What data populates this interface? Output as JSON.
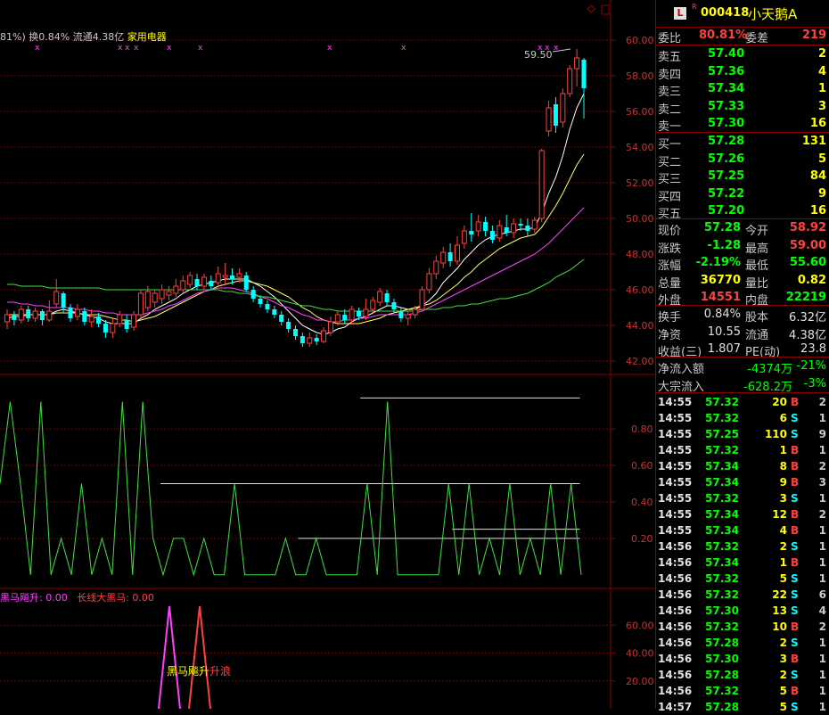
{
  "stock": {
    "code": "000418",
    "name": "小天鹅A",
    "badge": "L",
    "badge_sup": "R"
  },
  "info_bar": {
    "turnover_prefix": "81%) ",
    "turnover": "换0.84%",
    "float": "流通4.38亿",
    "sector": "家用电器"
  },
  "price_chart": {
    "ylim": [
      41.5,
      61
    ],
    "yticks": [
      "60.00",
      "58.00",
      "56.00",
      "54.00",
      "52.00",
      "50.00",
      "48.00",
      "46.00",
      "44.00",
      "42.00"
    ],
    "peak_label": "59.50",
    "candles": [
      {
        "o": 44.2,
        "c": 44.6,
        "h": 44.9,
        "l": 43.8
      },
      {
        "o": 44.6,
        "c": 44.3,
        "h": 44.8,
        "l": 44.0
      },
      {
        "o": 44.3,
        "c": 44.9,
        "h": 45.1,
        "l": 44.1
      },
      {
        "o": 44.9,
        "c": 44.4,
        "h": 45.1,
        "l": 44.2
      },
      {
        "o": 44.4,
        "c": 44.8,
        "h": 45.0,
        "l": 44.2
      },
      {
        "o": 44.8,
        "c": 44.3,
        "h": 44.9,
        "l": 44.0
      },
      {
        "o": 44.3,
        "c": 44.8,
        "h": 45.4,
        "l": 44.2
      },
      {
        "o": 45.2,
        "c": 45.9,
        "h": 46.6,
        "l": 45.0
      },
      {
        "o": 45.8,
        "c": 45.0,
        "h": 45.9,
        "l": 44.7
      },
      {
        "o": 45.0,
        "c": 44.4,
        "h": 45.2,
        "l": 44.2
      },
      {
        "o": 44.5,
        "c": 44.9,
        "h": 45.2,
        "l": 44.3
      },
      {
        "o": 44.8,
        "c": 44.2,
        "h": 45.0,
        "l": 44.0
      },
      {
        "o": 44.2,
        "c": 44.5,
        "h": 44.9,
        "l": 43.9
      },
      {
        "o": 44.5,
        "c": 44.1,
        "h": 44.7,
        "l": 43.9
      },
      {
        "o": 44.1,
        "c": 43.6,
        "h": 44.3,
        "l": 43.3
      },
      {
        "o": 43.6,
        "c": 44.1,
        "h": 44.4,
        "l": 43.3
      },
      {
        "o": 44.1,
        "c": 44.6,
        "h": 44.8,
        "l": 43.9
      },
      {
        "o": 44.3,
        "c": 43.8,
        "h": 44.6,
        "l": 43.6
      },
      {
        "o": 43.9,
        "c": 44.6,
        "h": 44.8,
        "l": 43.7
      },
      {
        "o": 44.6,
        "c": 45.8,
        "h": 46.0,
        "l": 44.4
      },
      {
        "o": 45.0,
        "c": 45.9,
        "h": 46.2,
        "l": 44.8
      },
      {
        "o": 45.3,
        "c": 45.8,
        "h": 46.0,
        "l": 45.0
      },
      {
        "o": 45.5,
        "c": 46.0,
        "h": 46.3,
        "l": 45.2
      },
      {
        "o": 45.7,
        "c": 45.9,
        "h": 46.2,
        "l": 45.4
      },
      {
        "o": 45.8,
        "c": 46.2,
        "h": 46.6,
        "l": 45.6
      },
      {
        "o": 46.0,
        "c": 46.5,
        "h": 46.8,
        "l": 45.8
      },
      {
        "o": 46.3,
        "c": 46.8,
        "h": 47.0,
        "l": 46.1
      },
      {
        "o": 46.6,
        "c": 46.2,
        "h": 46.9,
        "l": 46.0
      },
      {
        "o": 46.2,
        "c": 46.7,
        "h": 46.9,
        "l": 46.0
      },
      {
        "o": 46.5,
        "c": 46.2,
        "h": 46.8,
        "l": 46.0
      },
      {
        "o": 46.4,
        "c": 46.9,
        "h": 47.3,
        "l": 46.2
      },
      {
        "o": 46.7,
        "c": 46.8,
        "h": 47.5,
        "l": 46.3
      },
      {
        "o": 46.8,
        "c": 46.6,
        "h": 47.2,
        "l": 46.3
      },
      {
        "o": 46.7,
        "c": 46.9,
        "h": 47.2,
        "l": 46.4
      },
      {
        "o": 46.8,
        "c": 46.0,
        "h": 47.0,
        "l": 45.9
      },
      {
        "o": 46.0,
        "c": 45.5,
        "h": 46.2,
        "l": 45.3
      },
      {
        "o": 45.5,
        "c": 45.2,
        "h": 45.7,
        "l": 45.0
      },
      {
        "o": 45.2,
        "c": 44.9,
        "h": 45.4,
        "l": 44.7
      },
      {
        "o": 44.9,
        "c": 44.6,
        "h": 45.1,
        "l": 44.4
      },
      {
        "o": 44.6,
        "c": 44.2,
        "h": 44.8,
        "l": 44.0
      },
      {
        "o": 44.2,
        "c": 43.8,
        "h": 44.4,
        "l": 43.6
      },
      {
        "o": 43.8,
        "c": 43.4,
        "h": 44.0,
        "l": 43.2
      },
      {
        "o": 43.4,
        "c": 43.0,
        "h": 43.6,
        "l": 42.8
      },
      {
        "o": 43.0,
        "c": 43.3,
        "h": 43.6,
        "l": 42.8
      },
      {
        "o": 43.3,
        "c": 43.1,
        "h": 43.5,
        "l": 42.9
      },
      {
        "o": 43.1,
        "c": 43.7,
        "h": 43.9,
        "l": 43.0
      },
      {
        "o": 43.6,
        "c": 44.2,
        "h": 44.5,
        "l": 43.4
      },
      {
        "o": 44.2,
        "c": 44.6,
        "h": 44.8,
        "l": 44.0
      },
      {
        "o": 44.6,
        "c": 44.3,
        "h": 44.9,
        "l": 44.1
      },
      {
        "o": 44.3,
        "c": 44.9,
        "h": 45.1,
        "l": 44.1
      },
      {
        "o": 44.8,
        "c": 44.5,
        "h": 45.0,
        "l": 44.3
      },
      {
        "o": 44.5,
        "c": 44.9,
        "h": 45.5,
        "l": 44.3
      },
      {
        "o": 44.9,
        "c": 45.4,
        "h": 45.6,
        "l": 44.7
      },
      {
        "o": 45.3,
        "c": 45.9,
        "h": 46.1,
        "l": 45.1
      },
      {
        "o": 45.8,
        "c": 45.3,
        "h": 46.0,
        "l": 45.1
      },
      {
        "o": 45.3,
        "c": 44.9,
        "h": 45.5,
        "l": 44.7
      },
      {
        "o": 44.8,
        "c": 44.4,
        "h": 45.0,
        "l": 44.2
      },
      {
        "o": 44.4,
        "c": 44.6,
        "h": 44.8,
        "l": 44.0
      },
      {
        "o": 44.6,
        "c": 44.9,
        "h": 45.1,
        "l": 44.4
      },
      {
        "o": 44.9,
        "c": 46.0,
        "h": 46.2,
        "l": 44.8
      },
      {
        "o": 46.0,
        "c": 46.9,
        "h": 47.2,
        "l": 45.8
      },
      {
        "o": 46.9,
        "c": 47.6,
        "h": 47.9,
        "l": 46.6
      },
      {
        "o": 47.5,
        "c": 48.1,
        "h": 48.4,
        "l": 47.2
      },
      {
        "o": 48.1,
        "c": 47.6,
        "h": 48.6,
        "l": 47.3
      },
      {
        "o": 47.6,
        "c": 48.5,
        "h": 49.0,
        "l": 47.4
      },
      {
        "o": 48.6,
        "c": 49.3,
        "h": 49.6,
        "l": 48.3
      },
      {
        "o": 49.3,
        "c": 49.1,
        "h": 50.3,
        "l": 48.7
      },
      {
        "o": 49.3,
        "c": 49.8,
        "h": 50.2,
        "l": 49.0
      },
      {
        "o": 49.8,
        "c": 49.3,
        "h": 50.1,
        "l": 49.0
      },
      {
        "o": 49.3,
        "c": 48.8,
        "h": 49.6,
        "l": 48.6
      },
      {
        "o": 48.9,
        "c": 49.6,
        "h": 49.9,
        "l": 48.7
      },
      {
        "o": 49.5,
        "c": 49.2,
        "h": 50.2,
        "l": 49.0
      },
      {
        "o": 49.2,
        "c": 49.7,
        "h": 50.0,
        "l": 48.9
      },
      {
        "o": 49.7,
        "c": 49.6,
        "h": 50.0,
        "l": 49.3
      },
      {
        "o": 49.6,
        "c": 49.3,
        "h": 50.0,
        "l": 49.0
      },
      {
        "o": 49.4,
        "c": 49.9,
        "h": 50.1,
        "l": 49.2
      },
      {
        "o": 50.0,
        "c": 53.8,
        "h": 53.9,
        "l": 49.8
      },
      {
        "o": 54.9,
        "c": 56.2,
        "h": 56.6,
        "l": 54.6
      },
      {
        "o": 56.4,
        "c": 55.2,
        "h": 56.8,
        "l": 54.8
      },
      {
        "o": 55.4,
        "c": 57.0,
        "h": 57.3,
        "l": 55.1
      },
      {
        "o": 57.0,
        "c": 58.4,
        "h": 58.6,
        "l": 56.8
      },
      {
        "o": 58.4,
        "c": 59.0,
        "h": 59.5,
        "l": 57.4
      },
      {
        "o": 58.9,
        "c": 57.3,
        "h": 59.0,
        "l": 55.6
      }
    ],
    "ma_lines": [
      {
        "color": "#ffffff",
        "values": [
          44.4,
          44.5,
          44.5,
          44.6,
          44.6,
          44.6,
          44.6,
          44.8,
          44.9,
          44.8,
          44.7,
          44.6,
          44.5,
          44.4,
          44.2,
          44.1,
          44.1,
          44.1,
          44.1,
          44.4,
          44.6,
          44.9,
          45.1,
          45.3,
          45.5,
          45.8,
          46.0,
          46.2,
          46.3,
          46.4,
          46.5,
          46.6,
          46.6,
          46.6,
          46.6,
          46.4,
          46.2,
          45.9,
          45.6,
          45.2,
          44.8,
          44.4,
          44.0,
          43.8,
          43.6,
          43.5,
          43.6,
          43.8,
          43.9,
          44.2,
          44.4,
          44.5,
          44.7,
          44.9,
          45.1,
          45.1,
          45.0,
          44.9,
          44.9,
          45.1,
          45.4,
          45.8,
          46.4,
          46.8,
          47.2,
          47.7,
          48.1,
          48.5,
          48.8,
          49.0,
          49.1,
          49.2,
          49.3,
          49.4,
          49.4,
          49.5,
          50.3,
          51.4,
          52.3,
          53.5,
          55.0,
          56.2,
          57.0
        ]
      },
      {
        "color": "#ffff66",
        "values": [
          44.6,
          44.6,
          44.6,
          44.6,
          44.6,
          44.6,
          44.6,
          44.7,
          44.7,
          44.7,
          44.7,
          44.6,
          44.6,
          44.6,
          44.5,
          44.4,
          44.3,
          44.3,
          44.2,
          44.3,
          44.4,
          44.5,
          44.7,
          44.9,
          45.1,
          45.3,
          45.5,
          45.7,
          45.9,
          46.0,
          46.2,
          46.3,
          46.4,
          46.5,
          46.5,
          46.4,
          46.3,
          46.2,
          46.0,
          45.8,
          45.6,
          45.3,
          45.0,
          44.8,
          44.5,
          44.3,
          44.2,
          44.1,
          44.1,
          44.1,
          44.1,
          44.2,
          44.3,
          44.4,
          44.6,
          44.7,
          44.8,
          44.9,
          45.0,
          45.1,
          45.2,
          45.4,
          45.7,
          46.0,
          46.3,
          46.7,
          47.0,
          47.4,
          47.7,
          48.0,
          48.3,
          48.5,
          48.7,
          48.9,
          49.0,
          49.1,
          49.5,
          50.1,
          50.7,
          51.4,
          52.2,
          53.0,
          53.6
        ]
      },
      {
        "color": "#ff40ff",
        "values": [
          45.3,
          45.3,
          45.2,
          45.2,
          45.1,
          45.1,
          45.0,
          45.0,
          45.0,
          45.0,
          44.9,
          44.9,
          44.8,
          44.8,
          44.7,
          44.7,
          44.6,
          44.6,
          44.6,
          44.6,
          44.7,
          44.8,
          44.9,
          45.1,
          45.2,
          45.4,
          45.6,
          45.8,
          45.9,
          46.0,
          46.1,
          46.1,
          46.1,
          46.0,
          45.9,
          45.8,
          45.6,
          45.5,
          45.3,
          45.1,
          45.0,
          44.8,
          44.6,
          44.5,
          44.3,
          44.3,
          44.2,
          44.2,
          44.3,
          44.3,
          44.4,
          44.4,
          44.5,
          44.6,
          44.6,
          44.6,
          44.6,
          44.6,
          44.7,
          44.8,
          45.0,
          45.2,
          45.4,
          45.6,
          45.8,
          46.0,
          46.2,
          46.4,
          46.6,
          46.8,
          47.0,
          47.2,
          47.4,
          47.6,
          47.8,
          48.0,
          48.3,
          48.6,
          49.0,
          49.4,
          49.8,
          50.2,
          50.6
        ]
      },
      {
        "color": "#40e040",
        "values": [
          46.3,
          46.3,
          46.2,
          46.2,
          46.2,
          46.2,
          46.1,
          46.1,
          46.1,
          46.1,
          46.1,
          46.1,
          46.1,
          46.1,
          46.0,
          46.0,
          46.0,
          46.0,
          46.0,
          46.0,
          46.0,
          46.0,
          46.0,
          46.0,
          46.0,
          46.0,
          46.0,
          46.0,
          46.0,
          46.0,
          46.0,
          45.9,
          45.9,
          45.8,
          45.8,
          45.7,
          45.6,
          45.6,
          45.5,
          45.4,
          45.3,
          45.2,
          45.1,
          45.1,
          45.0,
          44.9,
          44.9,
          44.8,
          44.8,
          44.8,
          44.8,
          44.8,
          44.8,
          44.8,
          44.8,
          44.8,
          44.8,
          44.8,
          44.8,
          44.9,
          44.9,
          44.9,
          45.0,
          45.0,
          45.1,
          45.1,
          45.2,
          45.2,
          45.3,
          45.4,
          45.5,
          45.5,
          45.6,
          45.7,
          45.8,
          46.0,
          46.2,
          46.4,
          46.7,
          46.9,
          47.1,
          47.4,
          47.7
        ]
      }
    ]
  },
  "osc_chart": {
    "ylim": [
      -0.05,
      1.05
    ],
    "yticks": [
      "0.80",
      "0.60",
      "0.40",
      "0.20"
    ],
    "line_color": "#40e040",
    "values": [
      0.5,
      0.95,
      0.5,
      0.0,
      0.95,
      0.0,
      0.2,
      0.0,
      0.5,
      0.0,
      0.2,
      0.0,
      0.95,
      0.0,
      0.95,
      0.2,
      0.0,
      0.2,
      0.2,
      0.0,
      0.2,
      0.0,
      0.0,
      0.5,
      0.0,
      0.0,
      0.0,
      0.0,
      0.2,
      0.0,
      0.0,
      0.2,
      0.0,
      0.0,
      0.0,
      0.0,
      0.5,
      0.0,
      0.95,
      0.0,
      0.0,
      0.0,
      0.0,
      0.0,
      0.5,
      0.0,
      0.5,
      0.0,
      0.2,
      0.0,
      0.5,
      0.0,
      0.2,
      0.0,
      0.5,
      0.0,
      0.5,
      0.0
    ],
    "hlines": [
      {
        "y": 0.97,
        "x0": 0.55,
        "x1": 0.885
      },
      {
        "y": 0.5,
        "x0": 0.245,
        "x1": 0.885
      },
      {
        "y": 0.25,
        "x0": 0.69,
        "x1": 0.885
      },
      {
        "y": 0.2,
        "x0": 0.455,
        "x1": 0.885
      }
    ]
  },
  "bottom_chart": {
    "legend": [
      {
        "text": "黑马飚升: 0.00",
        "color": "#ff40ff"
      },
      {
        "text": "长线大黑马: 0.00",
        "color": "#ff4040"
      }
    ],
    "yticks": [
      "60.00",
      "40.00",
      "20.00"
    ],
    "signal_label_a": "黑马飚升",
    "signal_label_b": "升浪"
  },
  "quote": {
    "weibi": {
      "label": "委比",
      "value": "80.81%",
      "diff_label": "委差",
      "diff": "219"
    },
    "asks": [
      {
        "label": "卖五",
        "price": "57.40",
        "vol": "2"
      },
      {
        "label": "卖四",
        "price": "57.36",
        "vol": "4"
      },
      {
        "label": "卖三",
        "price": "57.34",
        "vol": "1"
      },
      {
        "label": "卖二",
        "price": "57.33",
        "vol": "3"
      },
      {
        "label": "卖一",
        "price": "57.30",
        "vol": "16"
      }
    ],
    "bids": [
      {
        "label": "买一",
        "price": "57.28",
        "vol": "131"
      },
      {
        "label": "买二",
        "price": "57.26",
        "vol": "5"
      },
      {
        "label": "买三",
        "price": "57.25",
        "vol": "84"
      },
      {
        "label": "买四",
        "price": "57.22",
        "vol": "9"
      },
      {
        "label": "买五",
        "price": "57.20",
        "vol": "16"
      }
    ],
    "stats": [
      {
        "l1": "现价",
        "v1": "57.28",
        "c1": "green",
        "l2": "今开",
        "v2": "58.92",
        "c2": "red"
      },
      {
        "l1": "涨跌",
        "v1": "-1.28",
        "c1": "green",
        "l2": "最高",
        "v2": "59.00",
        "c2": "red"
      },
      {
        "l1": "涨幅",
        "v1": "-2.19%",
        "c1": "green",
        "l2": "最低",
        "v2": "55.60",
        "c2": "green"
      },
      {
        "l1": "总量",
        "v1": "36770",
        "c1": "yellow",
        "l2": "量比",
        "v2": "0.82",
        "c2": "yellow"
      },
      {
        "l1": "外盘",
        "v1": "14551",
        "c1": "red",
        "l2": "内盘",
        "v2": "22219",
        "c2": "green"
      }
    ],
    "fund": [
      {
        "l1": "换手",
        "v1": "0.84%",
        "l2": "股本",
        "v2": "6.32亿"
      },
      {
        "l1": "净资",
        "v1": "10.55",
        "l2": "流通",
        "v2": "4.38亿"
      },
      {
        "l1": "收益(三)",
        "v1": "1.807",
        "l2": "PE(动)",
        "v2": "23.8"
      }
    ],
    "flow": [
      {
        "label": "净流入额",
        "value": "-4374万",
        "pct": "-21%"
      },
      {
        "label": "大宗流入",
        "value": "-628.2万",
        "pct": "-3%"
      }
    ]
  },
  "ticks": [
    {
      "t": "14:55",
      "p": "57.32",
      "v": "20",
      "s": "B",
      "n": "2"
    },
    {
      "t": "14:55",
      "p": "57.32",
      "v": "6",
      "s": "S",
      "n": "1"
    },
    {
      "t": "14:55",
      "p": "57.25",
      "v": "110",
      "s": "S",
      "n": "9"
    },
    {
      "t": "14:55",
      "p": "57.32",
      "v": "1",
      "s": "B",
      "n": "1"
    },
    {
      "t": "14:55",
      "p": "57.34",
      "v": "8",
      "s": "B",
      "n": "2"
    },
    {
      "t": "14:55",
      "p": "57.34",
      "v": "9",
      "s": "B",
      "n": "3"
    },
    {
      "t": "14:55",
      "p": "57.32",
      "v": "3",
      "s": "S",
      "n": "1"
    },
    {
      "t": "14:55",
      "p": "57.34",
      "v": "12",
      "s": "B",
      "n": "2"
    },
    {
      "t": "14:55",
      "p": "57.34",
      "v": "4",
      "s": "B",
      "n": "1"
    },
    {
      "t": "14:56",
      "p": "57.32",
      "v": "2",
      "s": "S",
      "n": "1"
    },
    {
      "t": "14:56",
      "p": "57.34",
      "v": "1",
      "s": "B",
      "n": "1"
    },
    {
      "t": "14:56",
      "p": "57.32",
      "v": "5",
      "s": "S",
      "n": "1"
    },
    {
      "t": "14:56",
      "p": "57.32",
      "v": "22",
      "s": "S",
      "n": "6"
    },
    {
      "t": "14:56",
      "p": "57.30",
      "v": "13",
      "s": "S",
      "n": "4"
    },
    {
      "t": "14:56",
      "p": "57.32",
      "v": "10",
      "s": "B",
      "n": "2"
    },
    {
      "t": "14:56",
      "p": "57.28",
      "v": "2",
      "s": "S",
      "n": "1"
    },
    {
      "t": "14:56",
      "p": "57.30",
      "v": "3",
      "s": "B",
      "n": "1"
    },
    {
      "t": "14:56",
      "p": "57.28",
      "v": "2",
      "s": "S",
      "n": "1"
    },
    {
      "t": "14:56",
      "p": "57.32",
      "v": "5",
      "s": "B",
      "n": "1"
    },
    {
      "t": "14:57",
      "p": "57.28",
      "v": "5",
      "s": "S",
      "n": "1"
    }
  ]
}
